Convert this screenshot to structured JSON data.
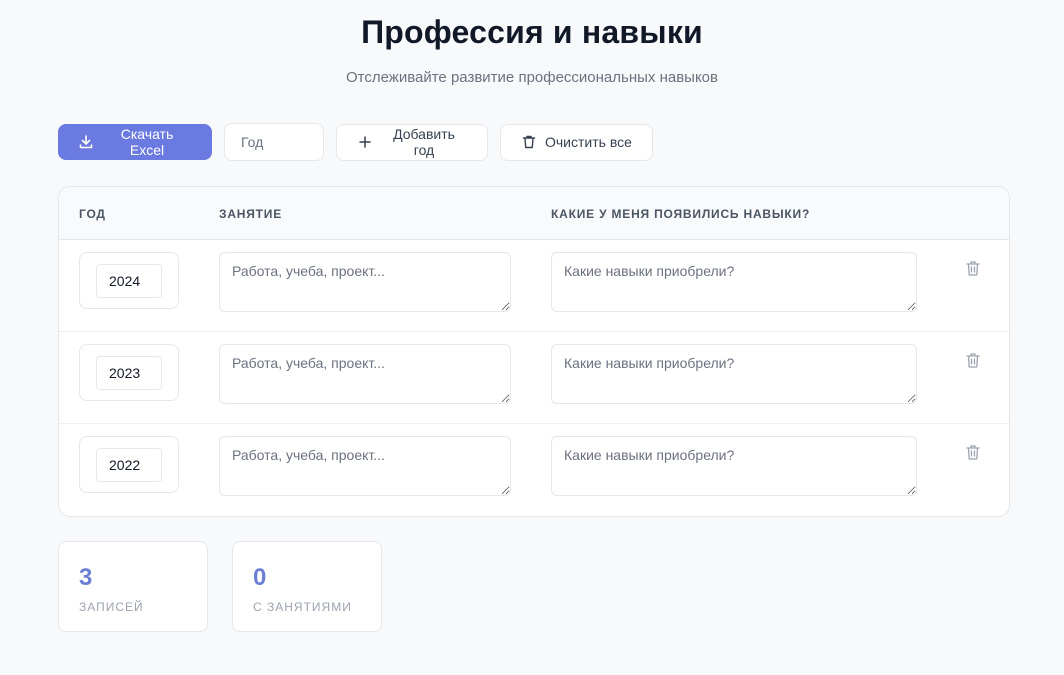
{
  "header": {
    "title": "Профессия и навыки",
    "subtitle": "Отслеживайте развитие профессиональных навыков"
  },
  "toolbar": {
    "download_label": "Скачать Excel",
    "year_placeholder": "Год",
    "add_label": "Добавить год",
    "clear_label": "Очистить все"
  },
  "table": {
    "columns": [
      "ГОД",
      "ЗАНЯТИЕ",
      "КАКИЕ У МЕНЯ ПОЯВИЛИСЬ НАВЫКИ?"
    ],
    "occupation_placeholder": "Работа, учеба, проект...",
    "skills_placeholder": "Какие навыки приобрели?",
    "rows": [
      {
        "year": "2024",
        "occupation": "",
        "skills": ""
      },
      {
        "year": "2023",
        "occupation": "",
        "skills": ""
      },
      {
        "year": "2022",
        "occupation": "",
        "skills": ""
      }
    ]
  },
  "stats": [
    {
      "value": "3",
      "label": "ЗАПИСЕЙ"
    },
    {
      "value": "0",
      "label": "С ЗАНЯТИЯМИ"
    }
  ],
  "colors": {
    "accent": "#6b7ae0",
    "stat_number": "#6b7fd4",
    "background": "#f8f9fa"
  },
  "icons": {
    "download": "download-icon",
    "add": "plus-icon",
    "clear": "trash-icon",
    "row_delete": "trash-icon"
  }
}
